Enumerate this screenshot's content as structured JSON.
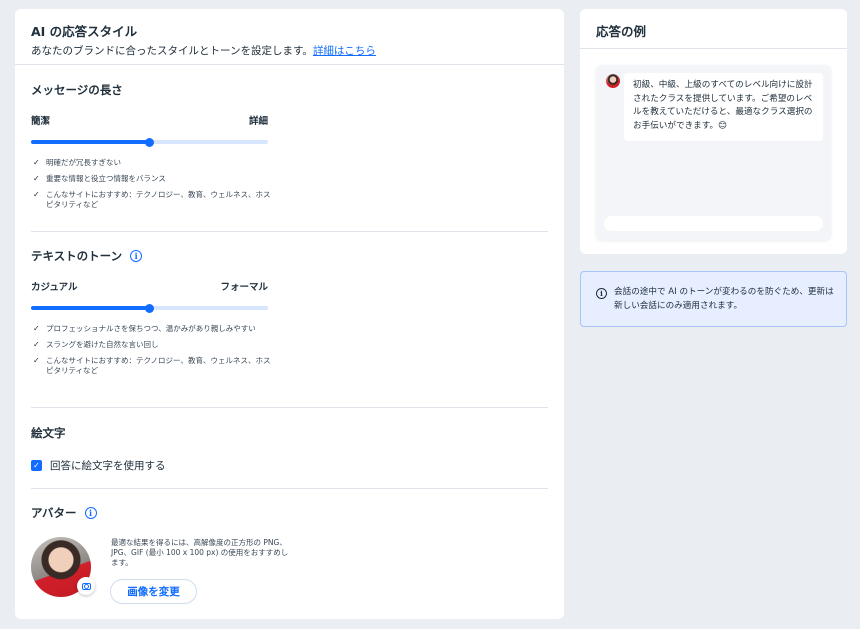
{
  "header": {
    "title": "AI の応答スタイル",
    "subtitle": "あなたのブランドに合ったスタイルとトーンを設定します。",
    "link": "詳細はこちら"
  },
  "message_length": {
    "title": "メッセージの長さ",
    "min_label": "簡潔",
    "max_label": "詳細",
    "value": 0.5,
    "bullets": [
      "明確だが冗長すぎない",
      "重要な情報と役立つ情報をバランス",
      "こんなサイトにおすすめ：テクノロジー、教育、ウェルネス、ホスピタリティなど"
    ]
  },
  "text_tone": {
    "title": "テキストのトーン",
    "info_icon": "i",
    "min_label": "カジュアル",
    "max_label": "フォーマル",
    "value": 0.5,
    "bullets": [
      "プロフェッショナルさを保ちつつ、温かみがあり親しみやすい",
      "スラングを避けた自然な言い回し",
      "こんなサイトにおすすめ：テクノロジー、教育、ウェルネス、ホスピタリティなど"
    ]
  },
  "emoji": {
    "title": "絵文字",
    "checkbox_label": "回答に絵文字を使用する",
    "checked": true
  },
  "avatar": {
    "title": "アバター",
    "info_icon": "i",
    "description": "最適な結果を得るには、高解像度の正方形の PNG、JPG、GIF (最小 100 x 100 px) の使用をおすすめします。",
    "change_button": "画像を変更"
  },
  "preview": {
    "title": "応答の例",
    "message": "初級、中級、上級のすべてのレベル向けに設計されたクラスを提供しています。ご希望のレベルを教えていただけると、最適なクラス選択のお手伝いができます。😊",
    "input_placeholder": ""
  },
  "notice": {
    "icon": "i",
    "text": "会話の途中で AI のトーンが変わるのを防ぐため、更新は新しい会話にのみ適用されます。"
  },
  "colors": {
    "accent": "#116dff",
    "background": "#eaeef3",
    "notice_bg": "#e6eeff"
  }
}
